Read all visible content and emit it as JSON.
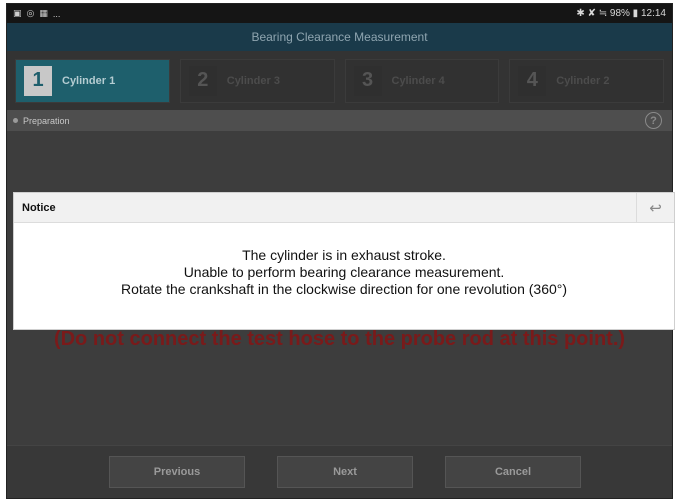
{
  "statusbar": {
    "left_icons": [
      "▣",
      "◎",
      "▦",
      "..."
    ],
    "right_text": "✱ ✘ ≒ 98% ▮ 12:14"
  },
  "titlebar": {
    "title": "Bearing Clearance Measurement"
  },
  "steps": [
    {
      "num": "1",
      "label": "Cylinder 1",
      "active": true
    },
    {
      "num": "2",
      "label": "Cylinder 3",
      "active": false
    },
    {
      "num": "3",
      "label": "Cylinder 4",
      "active": false
    },
    {
      "num": "4",
      "label": "Cylinder 2",
      "active": false
    }
  ],
  "prep": {
    "label": "Preparation",
    "help_glyph": "?"
  },
  "warning": {
    "text": "(Do not connect the test hose to the probe rod at this point.)"
  },
  "buttons": {
    "previous": "Previous",
    "next": "Next",
    "cancel": "Cancel"
  },
  "modal": {
    "title": "Notice",
    "back_glyph": "↩",
    "lines": [
      "The cylinder is in exhaust stroke.",
      "Unable to perform bearing clearance measurement.",
      "Rotate the crankshaft in the clockwise direction for one revolution (360°)"
    ]
  }
}
